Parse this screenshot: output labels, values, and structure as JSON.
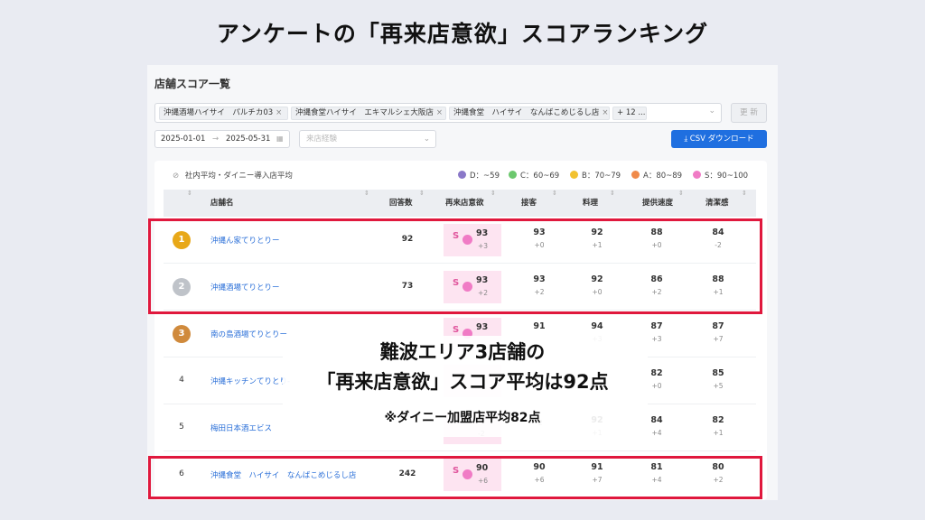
{
  "slide_title": "アンケートの「再来店意欲」スコアランキング",
  "panel": {
    "title": "店舗スコア一覧",
    "chips": [
      {
        "label": "沖縄酒場ハイサイ　パルチカ03"
      },
      {
        "label": "沖縄食堂ハイサイ　エキマルシェ大阪店"
      },
      {
        "label": "沖縄食堂　ハイサイ　なんばこめじるし店"
      },
      {
        "label": "+ 12 ..."
      }
    ],
    "update_label": "更 新",
    "date_from": "2025-01-01",
    "date_arrow": "→",
    "date_to": "2025-05-31",
    "visit_select_placeholder": "来店経験",
    "csv_label": "CSV ダウンロード"
  },
  "table": {
    "avg_label": "社内平均・ダイニー導入店平均",
    "legend": [
      {
        "label": "D：~59",
        "color": "#8a78c8"
      },
      {
        "label": "C：60~69",
        "color": "#6cc86e"
      },
      {
        "label": "B：70~79",
        "color": "#f2c230"
      },
      {
        "label": "A：80~89",
        "color": "#f08a4a"
      },
      {
        "label": "S：90~100",
        "color": "#f07bc5"
      }
    ],
    "headers": {
      "store": "店舗名",
      "answers": "回答数",
      "revisit": "再来店意欲",
      "service": "接客",
      "food": "料理",
      "speed": "提供速度",
      "clean": "清潔感"
    },
    "rows": [
      {
        "rank": "1",
        "medal_color": "#e8a818",
        "store": "沖縄ん家てりとりー",
        "answers": "92",
        "grade": "S",
        "revisit": "93",
        "revisit_diff": "+3",
        "service": "93",
        "service_diff": "+0",
        "food": "92",
        "food_diff": "+1",
        "speed": "88",
        "speed_diff": "+0",
        "clean": "84",
        "clean_diff": "-2"
      },
      {
        "rank": "2",
        "medal_color": "#bfc3c9",
        "store": "沖縄酒場てりとりー",
        "answers": "73",
        "grade": "S",
        "revisit": "93",
        "revisit_diff": "+2",
        "service": "93",
        "service_diff": "+2",
        "food": "92",
        "food_diff": "+0",
        "speed": "86",
        "speed_diff": "+2",
        "clean": "88",
        "clean_diff": "+1"
      },
      {
        "rank": "3",
        "medal_color": "#d08a3c",
        "store": "南の島酒場てりとりー",
        "answers": "",
        "grade": "S",
        "revisit": "93",
        "revisit_diff": "",
        "service": "91",
        "service_diff": "",
        "food": "94",
        "food_diff": "+3",
        "speed": "87",
        "speed_diff": "+3",
        "clean": "87",
        "clean_diff": "+7"
      },
      {
        "rank": "4",
        "store": "沖縄キッチンてりとり-",
        "answers": "",
        "grade": "",
        "revisit": "",
        "revisit_diff": "",
        "service": "",
        "service_diff": "",
        "food": "",
        "food_diff": "",
        "speed": "82",
        "speed_diff": "+0",
        "clean": "85",
        "clean_diff": "+5"
      },
      {
        "rank": "5",
        "store": "梅田日本酒エビス",
        "answers": "",
        "grade": "",
        "revisit": "",
        "revisit_diff": "-2",
        "service": "",
        "service_diff": "-2",
        "food": "92",
        "food_diff": "+1",
        "speed": "84",
        "speed_diff": "+4",
        "clean": "82",
        "clean_diff": "+1"
      },
      {
        "rank": "6",
        "store": "沖縄食堂　ハイサイ　なんばこめじるし店",
        "answers": "242",
        "grade": "S",
        "revisit": "90",
        "revisit_diff": "+6",
        "service": "90",
        "service_diff": "+6",
        "food": "91",
        "food_diff": "+7",
        "speed": "81",
        "speed_diff": "+4",
        "clean": "80",
        "clean_diff": "+2"
      }
    ]
  },
  "overlay": {
    "line1": "難波エリア3店舗の",
    "line2": "「再来店意欲」スコア平均は92点",
    "line3": "※ダイニー加盟店平均82点"
  }
}
